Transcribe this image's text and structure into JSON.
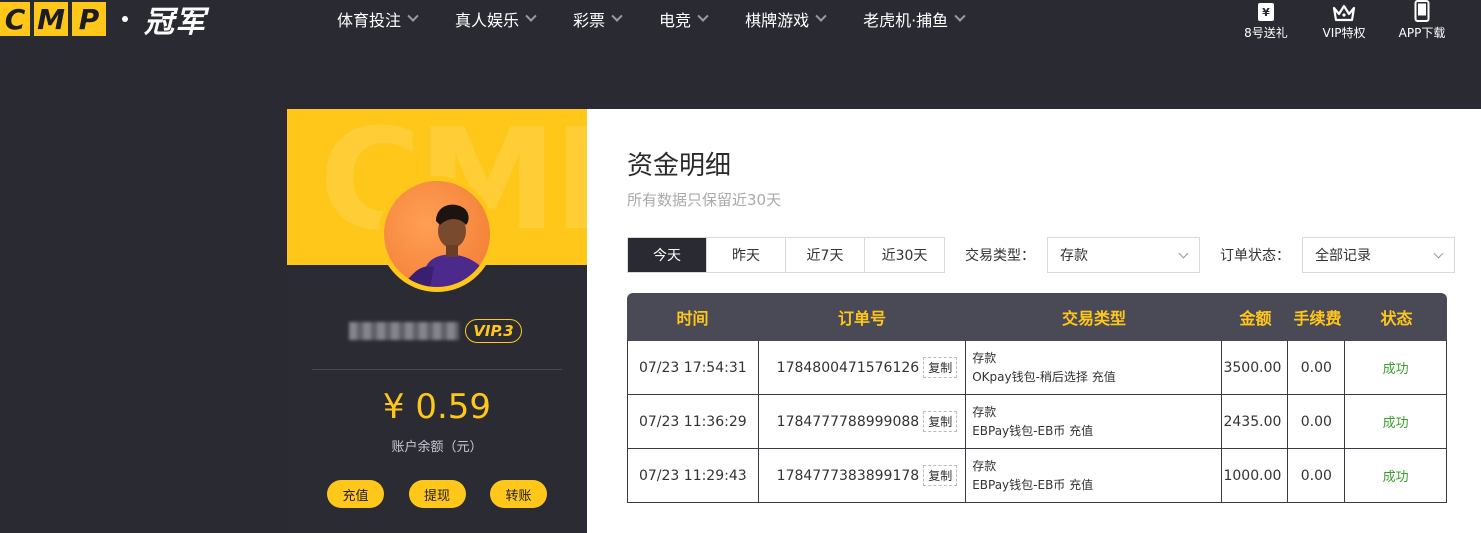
{
  "logo": {
    "letters": [
      "C",
      "M",
      "P"
    ],
    "name": "冠军"
  },
  "nav": [
    {
      "label": "体育投注"
    },
    {
      "label": "真人娱乐"
    },
    {
      "label": "彩票"
    },
    {
      "label": "电竞"
    },
    {
      "label": "棋牌游戏"
    },
    {
      "label": "老虎机·捕鱼"
    }
  ],
  "tools": [
    {
      "label": "8号送礼",
      "icon": "yen-gift-icon",
      "glyph": "¥"
    },
    {
      "label": "VIP特权",
      "icon": "crown-icon"
    },
    {
      "label": "APP下载",
      "icon": "phone-icon"
    }
  ],
  "profile": {
    "banner_text": "CMP",
    "vip": "VIP.3",
    "balance": "¥ 0.59",
    "balance_label": "账户余额（元）",
    "actions": [
      "充值",
      "提现",
      "转账"
    ]
  },
  "page": {
    "title": "资金明细",
    "subtitle": "所有数据只保留近30天"
  },
  "filters": {
    "periods": [
      {
        "label": "今天",
        "active": true
      },
      {
        "label": "昨天",
        "active": false
      },
      {
        "label": "近7天",
        "active": false
      },
      {
        "label": "近30天",
        "active": false
      }
    ],
    "type_label": "交易类型：",
    "type_value": "存款",
    "status_label": "订单状态：",
    "status_value": "全部记录"
  },
  "table": {
    "headers": [
      "时间",
      "订单号",
      "交易类型",
      "金额",
      "手续费",
      "状态"
    ],
    "copy_label": "复制",
    "rows": [
      {
        "time": "07/23 17:54:31",
        "order": "1784800471576126",
        "type": "存款",
        "detail": "OKpay钱包-稍后选择 充值",
        "amount": "3500.00",
        "fee": "0.00",
        "status": "成功"
      },
      {
        "time": "07/23 11:36:29",
        "order": "1784777788999088",
        "type": "存款",
        "detail": "EBPay钱包-EB币 充值",
        "amount": "2435.00",
        "fee": "0.00",
        "status": "成功"
      },
      {
        "time": "07/23 11:29:43",
        "order": "1784777383899178",
        "type": "存款",
        "detail": "EBPay钱包-EB币 充值",
        "amount": "1000.00",
        "fee": "0.00",
        "status": "成功"
      }
    ]
  },
  "colors": {
    "accent": "#ffc71a",
    "dark": "#2a2a33",
    "header": "#4a4a57",
    "success": "#3aa02d"
  }
}
